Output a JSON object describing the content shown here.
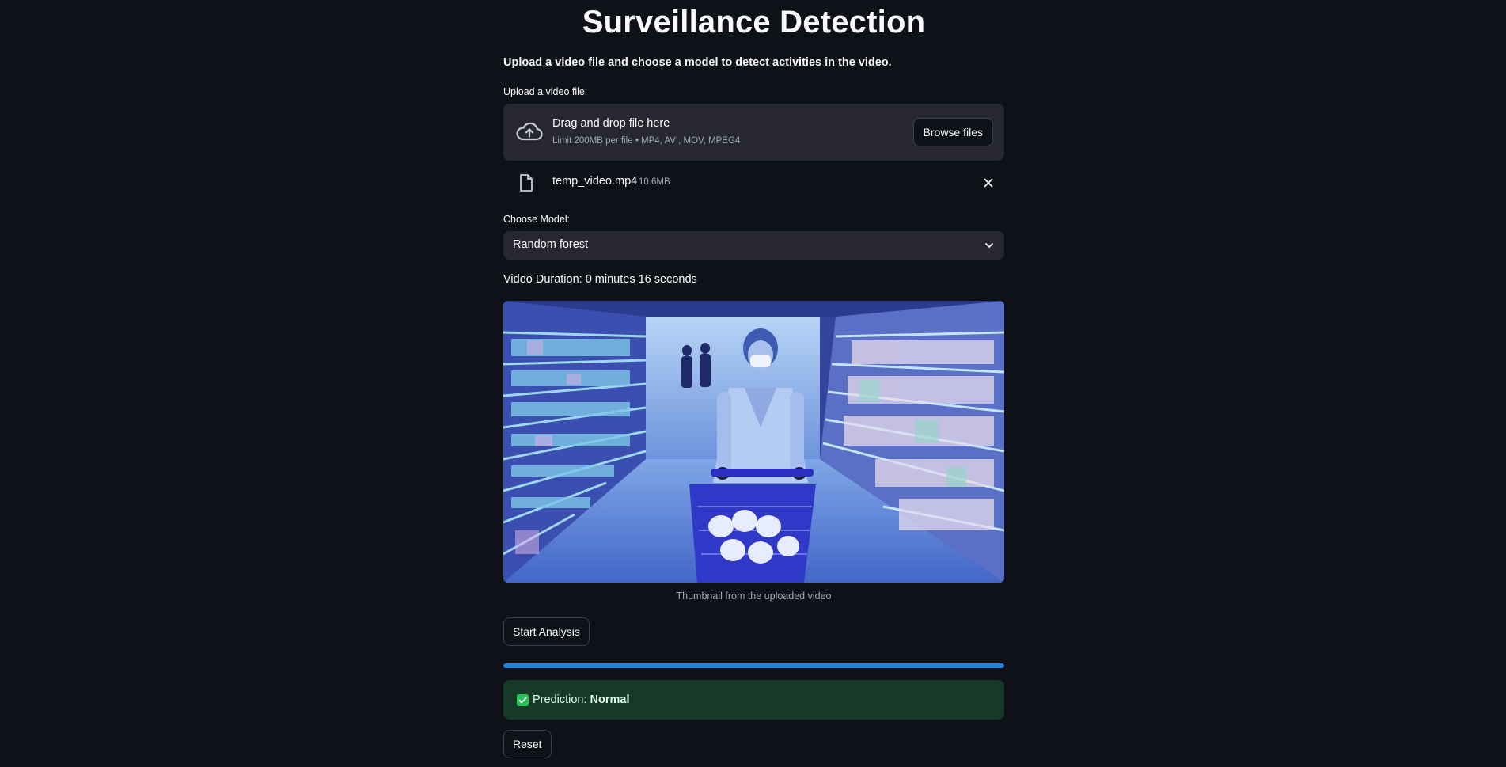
{
  "page": {
    "title": "Surveillance Detection",
    "subtitle": "Upload a video file and choose a model to detect activities in the video."
  },
  "uploader": {
    "label": "Upload a video file",
    "dropzone_title": "Drag and drop file here",
    "dropzone_limit": "Limit 200MB per file • MP4, AVI, MOV, MPEG4",
    "browse_label": "Browse files",
    "icon": "cloud-upload-icon",
    "file": {
      "name": "temp_video.mp4",
      "size": "10.6MB",
      "icon": "file-icon"
    }
  },
  "model_select": {
    "label": "Choose Model:",
    "value": "Random forest"
  },
  "video": {
    "duration_text": "Video Duration: 0 minutes 16 seconds",
    "thumbnail_caption": "Thumbnail from the uploaded video"
  },
  "actions": {
    "start_label": "Start Analysis",
    "reset_label": "Reset"
  },
  "progress": {
    "value_percent": 100
  },
  "result": {
    "prefix": "Prediction: ",
    "value": "Normal",
    "icon": "check-box-icon"
  },
  "colors": {
    "background": "#0e1117",
    "surface": "#262730",
    "progress": "#1c83e1",
    "success_bg": "#173928",
    "success_check": "#21c354"
  }
}
